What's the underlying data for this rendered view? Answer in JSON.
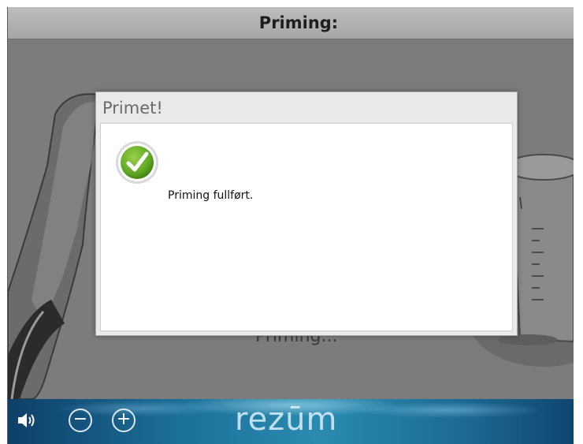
{
  "header": {
    "title": "Priming:"
  },
  "main": {
    "status_text": "Priming..."
  },
  "dialog": {
    "title": "Primet!",
    "message": "Priming fullført.",
    "icon": "check-circle-icon"
  },
  "footer": {
    "volume_icon": "speaker-icon",
    "minus_label": "−",
    "plus_label": "+",
    "logo_text": "rezūm"
  },
  "colors": {
    "title_bar": "#b3b3b3",
    "background_dim": "#7c7c7c",
    "success_green": "#6cb52d",
    "footer_blue": "#1b6f99"
  }
}
